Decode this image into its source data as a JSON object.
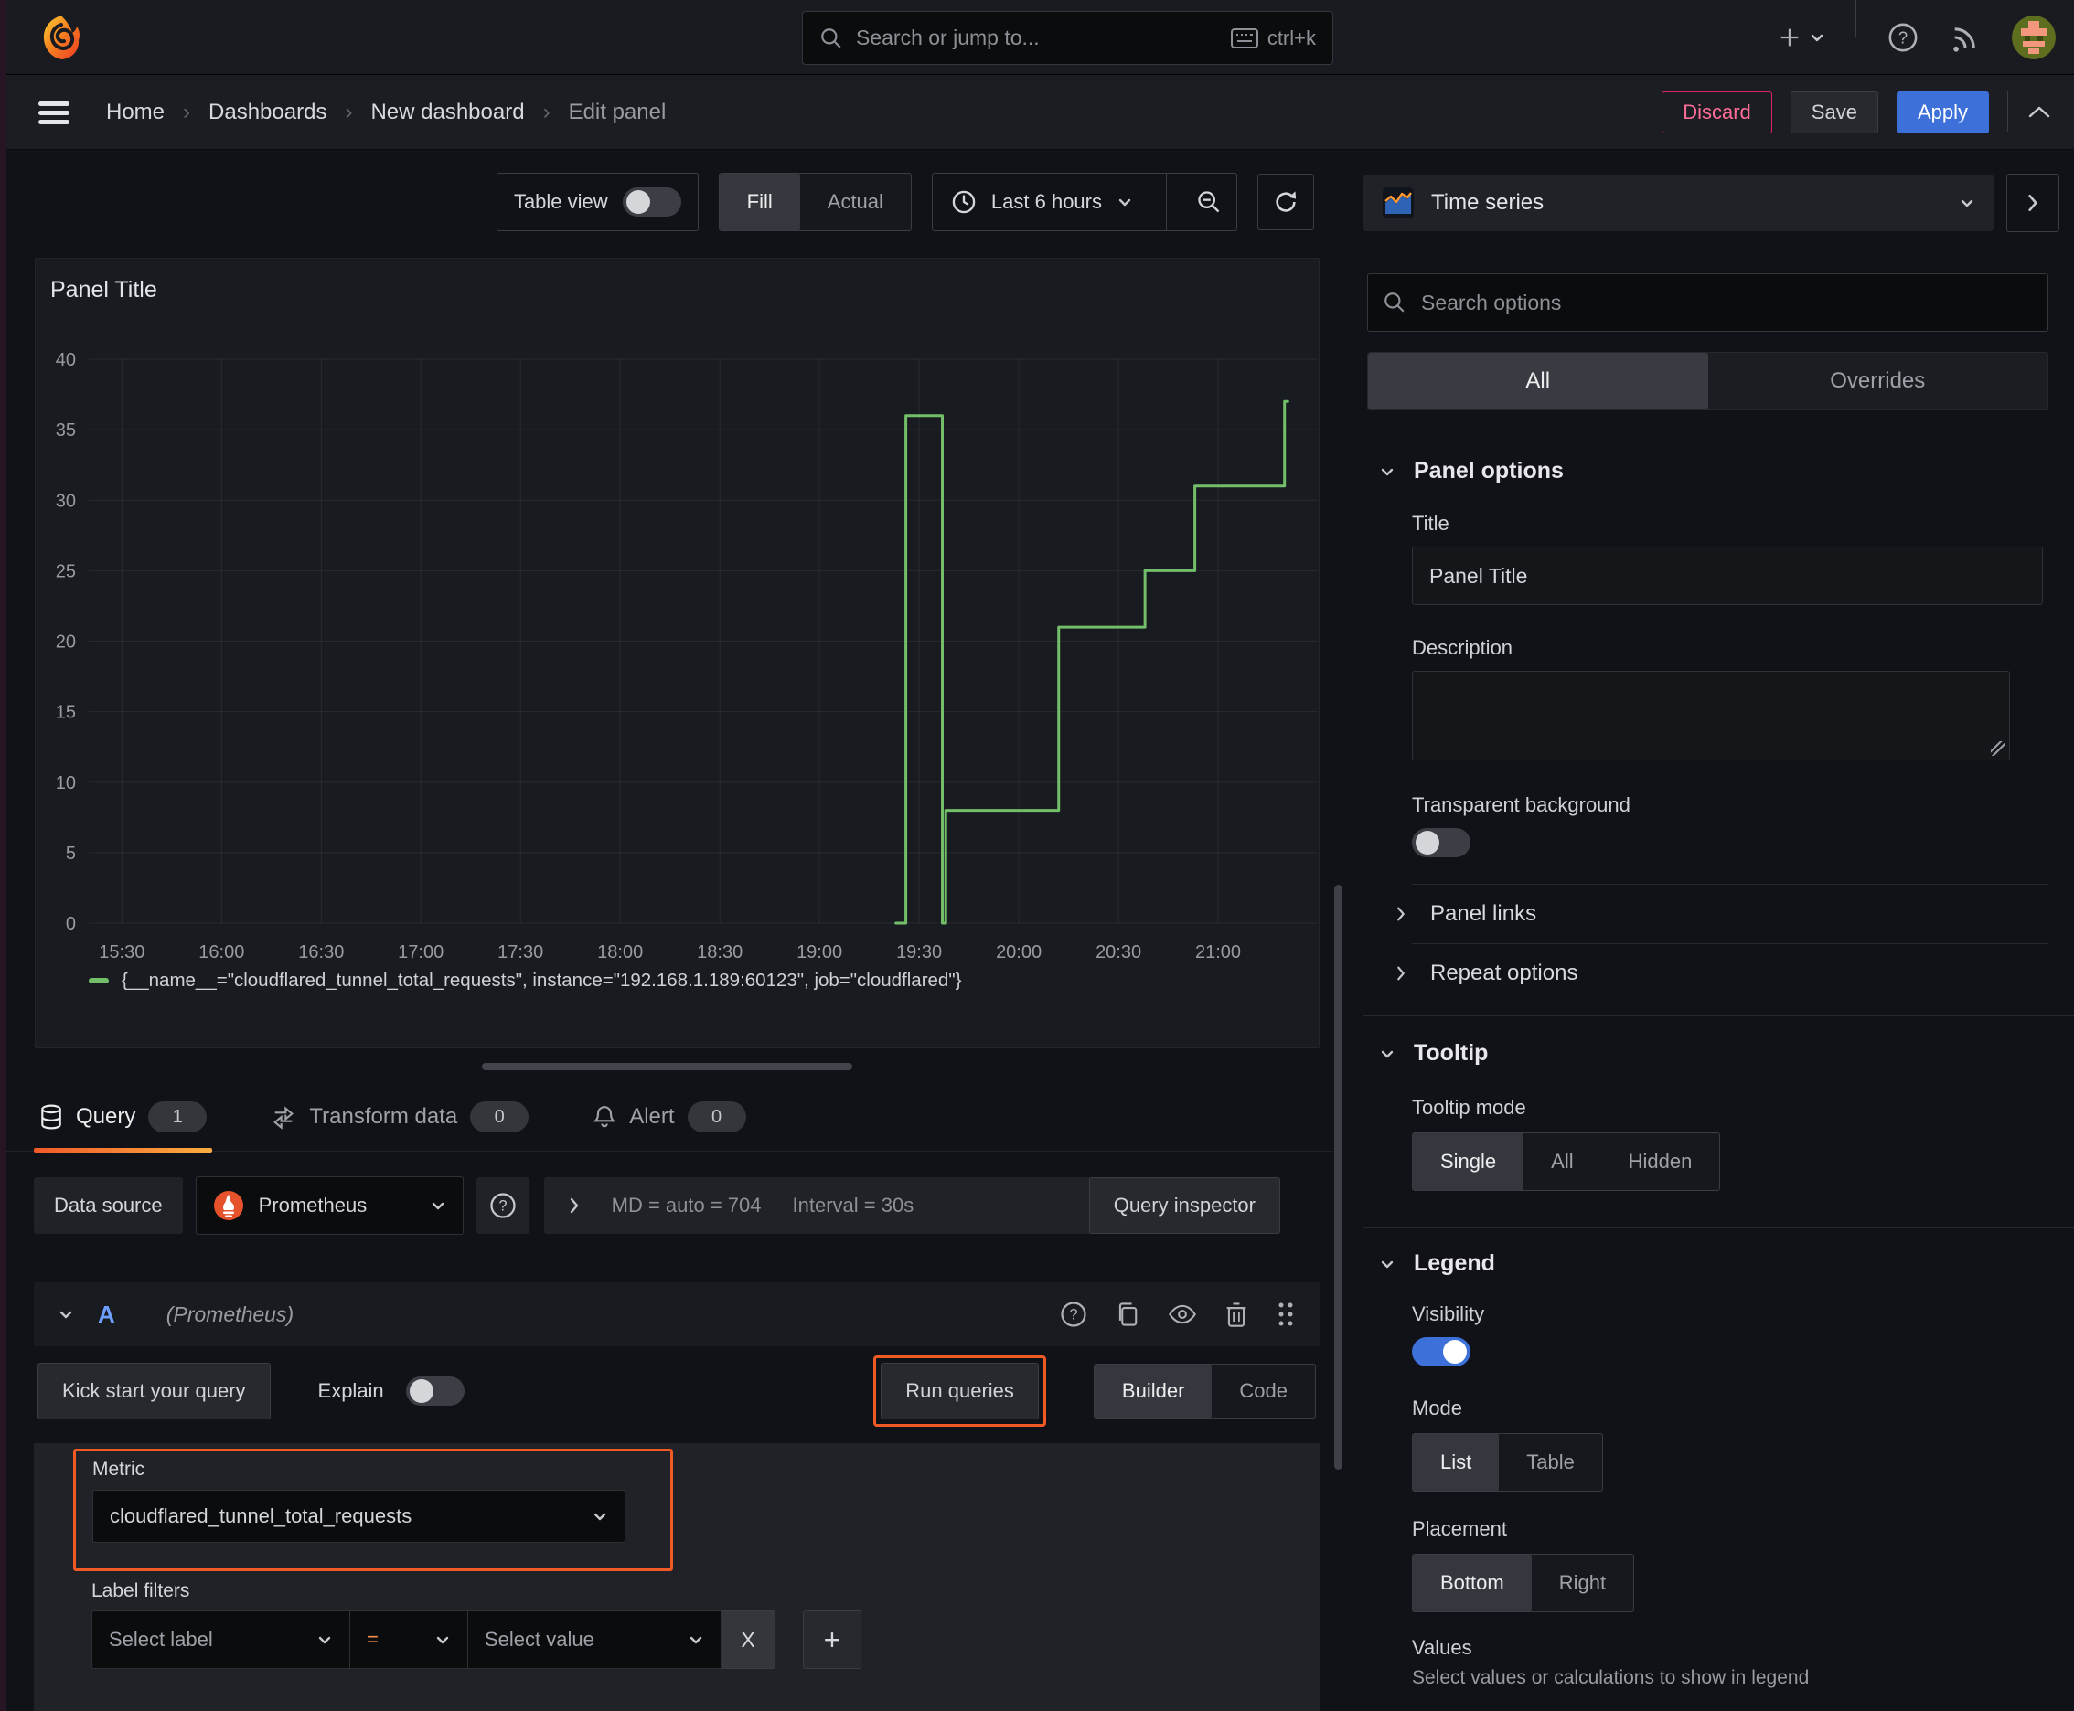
{
  "topbar": {
    "search": {
      "placeholder": "Search or jump to...",
      "shortcut": "ctrl+k"
    }
  },
  "breadcrumb": {
    "items": [
      {
        "label": "Home"
      },
      {
        "label": "Dashboards"
      },
      {
        "label": "New dashboard"
      },
      {
        "label": "Edit panel"
      }
    ],
    "actions": {
      "discard": "Discard",
      "save": "Save",
      "apply": "Apply"
    }
  },
  "viz_toolbar": {
    "table_view_label": "Table view",
    "fill_label": "Fill",
    "actual_label": "Actual",
    "time_range_label": "Last 6 hours"
  },
  "panel": {
    "title": "Panel Title"
  },
  "chart_data": {
    "type": "line",
    "title": "Panel Title",
    "xlabel": "",
    "ylabel": "",
    "grid": true,
    "legend_position": "bottom",
    "x_tick_labels": [
      "15:30",
      "16:00",
      "16:30",
      "17:00",
      "17:30",
      "18:00",
      "18:30",
      "19:00",
      "19:30",
      "20:00",
      "20:30",
      "21:00"
    ],
    "x_tick_minutes": [
      0,
      30,
      60,
      90,
      120,
      150,
      180,
      210,
      240,
      270,
      300,
      330
    ],
    "xlim_minutes": [
      -10,
      360
    ],
    "y_ticks": [
      0,
      5,
      10,
      15,
      20,
      25,
      30,
      35,
      40
    ],
    "ylim": [
      0,
      40
    ],
    "series": [
      {
        "name": "{__name__=\"cloudflared_tunnel_total_requests\", instance=\"192.168.1.189:60123\", job=\"cloudflared\"}",
        "color": "#73bf69",
        "points_minutes_value": [
          [
            233,
            0
          ],
          [
            236,
            0
          ],
          [
            236,
            36
          ],
          [
            247,
            36
          ],
          [
            247,
            0
          ],
          [
            248,
            0
          ],
          [
            248,
            8
          ],
          [
            282,
            8
          ],
          [
            282,
            21
          ],
          [
            308,
            21
          ],
          [
            308,
            25
          ],
          [
            323,
            25
          ],
          [
            323,
            31
          ],
          [
            350,
            31
          ],
          [
            350,
            37
          ],
          [
            351,
            37
          ]
        ]
      }
    ]
  },
  "query_section": {
    "tabs": [
      {
        "label": "Query",
        "count": "1"
      },
      {
        "label": "Transform data",
        "count": "0"
      },
      {
        "label": "Alert",
        "count": "0"
      }
    ],
    "datasource": {
      "label": "Data source",
      "name": "Prometheus",
      "stats_md": "MD = auto = 704",
      "stats_interval": "Interval = 30s",
      "inspector": "Query inspector"
    },
    "query_row": {
      "letter": "A",
      "datasource_hint": "(Prometheus)"
    },
    "toolbar": {
      "kickstart": "Kick start your query",
      "explain": "Explain",
      "run": "Run queries",
      "builder": "Builder",
      "code": "Code"
    },
    "metric": {
      "label": "Metric",
      "value": "cloudflared_tunnel_total_requests"
    },
    "label_filters": {
      "label": "Label filters",
      "select_label_placeholder": "Select label",
      "operator": "=",
      "select_value_placeholder": "Select value",
      "remove": "X",
      "add": "+"
    }
  },
  "options_pane": {
    "visualization": "Time series",
    "search_placeholder": "Search options",
    "tabs": [
      {
        "label": "All"
      },
      {
        "label": "Overrides"
      }
    ],
    "panel_options": {
      "header": "Panel options",
      "title_label": "Title",
      "title_value": "Panel Title",
      "description_label": "Description",
      "description_value": "",
      "transparent_label": "Transparent background"
    },
    "collapsed_sections": [
      {
        "label": "Panel links"
      },
      {
        "label": "Repeat options"
      }
    ],
    "tooltip": {
      "header": "Tooltip",
      "mode_label": "Tooltip mode",
      "modes": [
        {
          "label": "Single"
        },
        {
          "label": "All"
        },
        {
          "label": "Hidden"
        }
      ],
      "selected_mode": "Single"
    },
    "legend": {
      "header": "Legend",
      "visibility_label": "Visibility",
      "mode_label": "Mode",
      "modes": [
        {
          "label": "List"
        },
        {
          "label": "Table"
        }
      ],
      "selected_mode": "List",
      "placement_label": "Placement",
      "placements": [
        {
          "label": "Bottom"
        },
        {
          "label": "Right"
        }
      ],
      "selected_placement": "Bottom",
      "values_label": "Values",
      "values_hint": "Select values or calculations to show in legend"
    }
  },
  "colors": {
    "accent_orange": "#f15a24",
    "brand_orange": "#ff780a",
    "accent_blue": "#3d71d9",
    "series_green": "#73bf69",
    "danger_pink": "#e0226e"
  }
}
